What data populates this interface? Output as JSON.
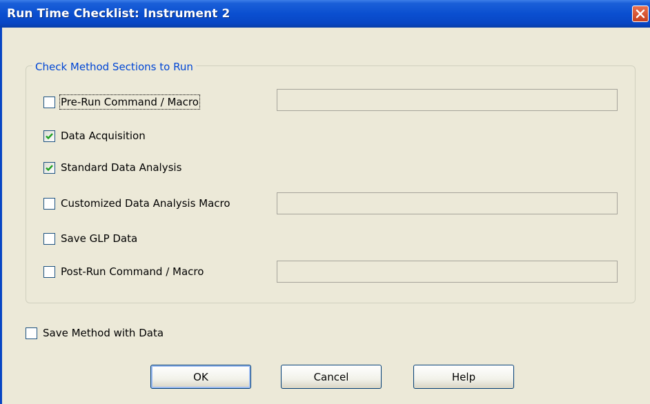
{
  "window": {
    "title": "Run Time Checklist: Instrument 2"
  },
  "group": {
    "title": "Check Method Sections to Run",
    "items": [
      {
        "label": "Pre-Run Command / Macro",
        "checked": false,
        "field_value": ""
      },
      {
        "label": "Data Acquisition",
        "checked": true
      },
      {
        "label": "Standard Data Analysis",
        "checked": true
      },
      {
        "label": "Customized Data Analysis Macro",
        "checked": false,
        "field_value": ""
      },
      {
        "label": "Save GLP Data",
        "checked": false
      },
      {
        "label": "Post-Run Command / Macro",
        "checked": false,
        "field_value": ""
      }
    ]
  },
  "save_method": {
    "label": "Save Method with Data",
    "checked": false
  },
  "buttons": {
    "ok": "OK",
    "cancel": "Cancel",
    "help": "Help"
  },
  "colors": {
    "titlebar": "#0a4fd0",
    "group_title": "#0046d5",
    "check": "#21a121",
    "dialog_bg": "#ece9d8"
  },
  "icons": {
    "close": "close-icon",
    "check": "checkmark-icon"
  }
}
